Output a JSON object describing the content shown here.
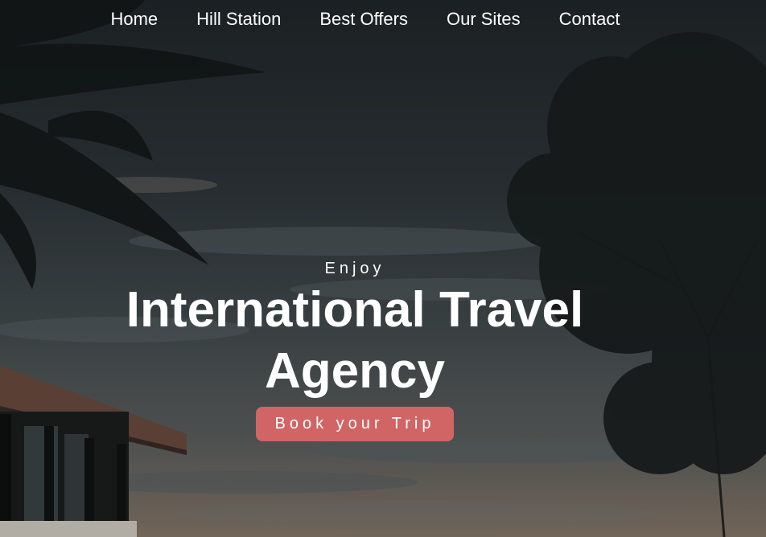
{
  "nav": {
    "items": [
      {
        "label": "Home"
      },
      {
        "label": "Hill Station"
      },
      {
        "label": "Best Offers"
      },
      {
        "label": "Our Sites"
      },
      {
        "label": "Contact"
      }
    ]
  },
  "hero": {
    "eyebrow": "Enjoy",
    "title": "International Travel Agency",
    "cta_label": "Book your Trip",
    "background_image": "tropical-sunset-palm-trees-veranda"
  },
  "colors": {
    "cta": "#d16565",
    "text": "#ffffff",
    "sky_dark": "#242a2f"
  }
}
